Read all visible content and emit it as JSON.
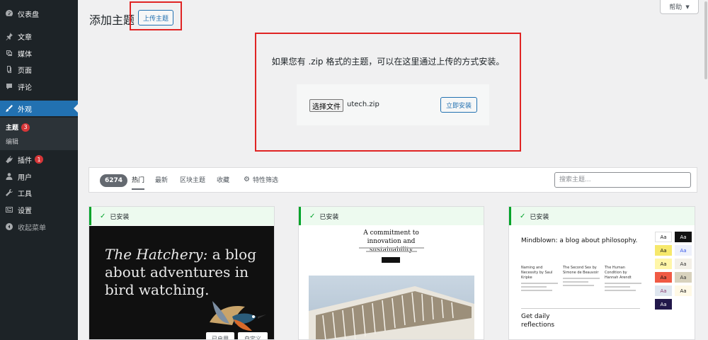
{
  "sidebar": {
    "items": [
      {
        "label": "仪表盘",
        "icon": "dashboard-icon"
      },
      {
        "label": "文章",
        "icon": "pushpin-icon"
      },
      {
        "label": "媒体",
        "icon": "media-icon"
      },
      {
        "label": "页面",
        "icon": "pages-icon"
      },
      {
        "label": "评论",
        "icon": "comments-icon"
      },
      {
        "label": "外观",
        "icon": "appearance-icon",
        "active": true
      },
      {
        "label": "插件",
        "icon": "plugins-icon",
        "badge": "1"
      },
      {
        "label": "用户",
        "icon": "users-icon"
      },
      {
        "label": "工具",
        "icon": "tools-icon"
      },
      {
        "label": "设置",
        "icon": "settings-icon"
      },
      {
        "label": "收起菜单",
        "icon": "collapse-icon"
      }
    ],
    "submenu": [
      {
        "label": "主题",
        "badge": "3",
        "current": true
      },
      {
        "label": "编辑"
      }
    ]
  },
  "header": {
    "title": "添加主题",
    "upload_label": "上传主题",
    "help_label": "帮助"
  },
  "upload": {
    "instruction": "如果您有 .zip 格式的主题，可以在这里通过上传的方式安装。",
    "choose_file_label": "选择文件",
    "file_name": "utech.zip",
    "install_label": "立即安装"
  },
  "filter": {
    "count": "6274",
    "tabs": [
      "热门",
      "最新",
      "区块主题",
      "收藏"
    ],
    "feature_filter_label": "特性筛选",
    "search_placeholder": "搜索主题..."
  },
  "themes": [
    {
      "installed_label": "已安装",
      "preview_italic": "The Hatchery:",
      "preview_rest": " a blog about adventures in bird watching.",
      "buttons": [
        "已启用",
        "自定义"
      ]
    },
    {
      "installed_label": "已安装",
      "preview_headline": "A commitment to innovation and sustainability"
    },
    {
      "installed_label": "已安装",
      "preview_title": "Mindblown: a blog about philosophy.",
      "columns": [
        "Naming and Necessity by Saul Kripke",
        "The Second Sex by Simone de Beauvoir",
        "The Human Condition by Hannah Arendt"
      ],
      "preview_footer": "Get daily reflections",
      "swatch_label": "Aa"
    }
  ],
  "colors": {
    "sidebar_bg": "#1d2327",
    "accent": "#2271b1",
    "installed_green": "#00a32a",
    "annotation_red": "#e02424"
  }
}
